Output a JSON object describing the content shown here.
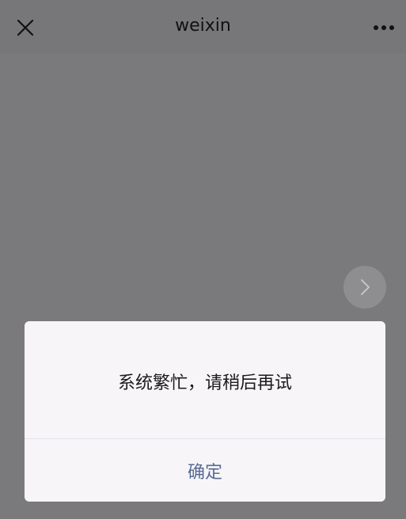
{
  "header": {
    "title": "weixin",
    "close_icon": "close-icon",
    "more_icon": "more-dots-icon"
  },
  "content": {
    "next_icon": "chevron-right-icon"
  },
  "dialog": {
    "message": "系统繁忙，请稍后再试",
    "confirm_label": "确定"
  },
  "colors": {
    "accent": "#576b95",
    "overlay": "#7a797c",
    "dialog_bg": "#f7f5f8"
  }
}
